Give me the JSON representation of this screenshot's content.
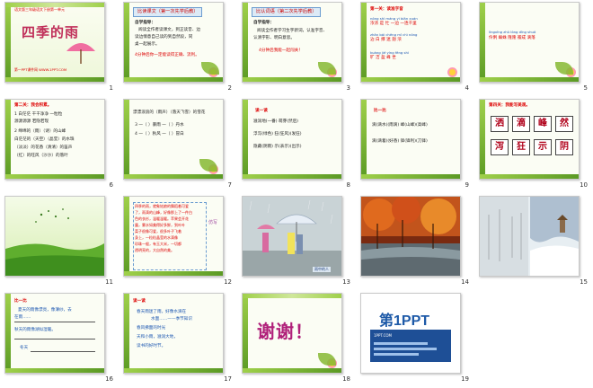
{
  "slides": [
    {
      "num": "1",
      "small": "语文版三年级语文下册第一单元",
      "title": "四季的雨",
      "footer": "第一PPT课件网 WWW.1PPT.COM"
    },
    {
      "num": "2",
      "banner": "比读课文（第一次先学后教）",
      "lines": [
        "自学指导：",
        "阅读全作者读课文，到正读音、边",
        "读边情意自己读的到自然段，同",
        "桌一起展示。",
        "4分钟后你一定能读得正确、流利。"
      ]
    },
    {
      "num": "3",
      "banner": "比认词语（第二次先学后教）",
      "lines": [
        "自学指导：",
        "阅读全作者学习生字新词，认准字音、",
        "认清字形、明白意思。",
        "4分钟后我能一起闯关！"
      ]
    },
    {
      "num": "4",
      "head": "第一关：读准字音",
      "lines": [
        "nóng  shì  máng  yì biān  xuán",
        "浓浓  是  忙   一边  一连千里",
        "zhān  bái  chēng  mǐ  chì  nóng",
        "沾    白  撑   迷  翅  浓",
        "kuàng jié  yíng  fēng  shì",
        "旷    洁  盈   峰  世"
      ]
    },
    {
      "num": "5",
      "lines": [
        "lìngxīng  zhū  lóng  dīng  shuō",
        "伶俐    蜘蛛  隆隆  瓣成  滴落"
      ]
    },
    {
      "num": "6",
      "head": "第二关：我会积累。",
      "lines": [
        "1 白茫茫  干干净净  一粒粒",
        "  源源源源  若隐若现",
        "2 绵绵的（雨）（诗）的山峰",
        "  白茫茫的（天空）（晶莹）的水珠",
        "  （淡淡）的花香（清清）的笛声",
        "  （红）的旺风（沙沙）的落叶"
      ]
    },
    {
      "num": "7",
      "head": "漂漂浪浪的（雨声）（落天飞雪）的雪花",
      "lines": [
        "3 一（ ）暴雨  一（ ）丹水",
        "4 一（ ）秋风  一（ ）冒白"
      ]
    },
    {
      "num": "8",
      "head": "读一读",
      "lines": [
        "滋润地(一番)  萌芽(然后)",
        "浮泻(绿色)  狂(狂风)(发狂)",
        "隐藏(阴雨)  示(表示)(出示)"
      ]
    },
    {
      "num": "9",
      "head": "比一比",
      "lines": [
        "滴(滴水)(雨滴)   峰(山峰)(高峰)",
        "滴(滴着)(好香)   锋(锋利)(刀锋)"
      ]
    },
    {
      "num": "10",
      "head": "第四关：我能写美观。",
      "chars": [
        "洒",
        "滴",
        "峰",
        "然",
        "泻",
        "狂",
        "示",
        "阴"
      ]
    },
    {
      "num": "11",
      "type": "photo-spring"
    },
    {
      "num": "12",
      "lines": [
        "四季的雨，就象姑娘的舞蹈着可爱",
        "了，雨滴的山峰，好像那上了一件白",
        "色的衣衫，温暖温暖。苹果会开花",
        "露，雾水如美得好多鲜，到叶叶",
        "菜子很像可爱，很多叶子飞着",
        "身上，一粒粒晶莹的水滴像",
        "珍珠一般，有玉大米，一切都",
        "透明亮的，大自然的美。"
      ],
      "side": "仿写"
    },
    {
      "num": "13",
      "type": "photo-rain",
      "caption": "雨中的人"
    },
    {
      "num": "14",
      "type": "photo-autumn"
    },
    {
      "num": "15",
      "type": "photo-winter"
    },
    {
      "num": "16",
      "head": "比一比",
      "lines": [
        "夏天的雨像漂亮，像薄纱，去",
        "在雨……",
        "秋天的雨像湖似湿暖。",
        "冬天"
      ]
    },
    {
      "num": "17",
      "head": "读一读",
      "lines": [
        "春天雨迷了雨，好像水滴在",
        "水面……——季节知识",
        "春风拂面的时光",
        "天和小雨，滋润大地，",
        "读书的好时节。"
      ]
    },
    {
      "num": "18",
      "thanks": "谢谢！"
    },
    {
      "num": "19",
      "logo": "第1PPT",
      "sub": "1PPT.COM"
    }
  ],
  "colors": {
    "accent": "#c0305a",
    "vine": "#86b832",
    "banner_border": "#6a9cd0"
  }
}
